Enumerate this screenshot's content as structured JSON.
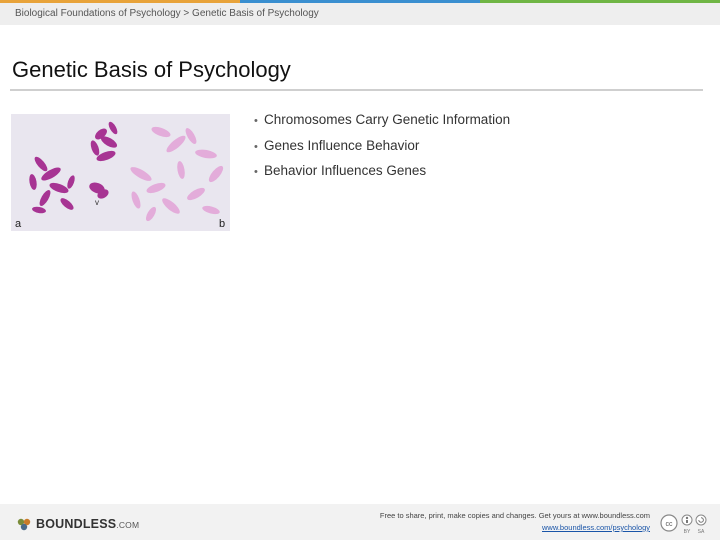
{
  "breadcrumb": "Biological Foundations of Psychology > Genetic Basis of Psychology",
  "title": "Genetic Basis of Psychology",
  "bullets": [
    "Chromosomes Carry Genetic Information",
    "Genes Influence Behavior",
    "Behavior Influences Genes"
  ],
  "figure": {
    "label_a": "a",
    "label_b": "b",
    "label_arrow": "v"
  },
  "footer": {
    "logo_text": "BOUNDLESS",
    "logo_suffix": ".COM",
    "notice": "Free to share, print, make copies and changes. Get yours at www.boundless.com",
    "link": "www.boundless.com/psychology",
    "license": [
      "BY",
      "SA"
    ]
  },
  "colors": {
    "strip": [
      "#e8a33a",
      "#3a8fd0",
      "#6fb544"
    ],
    "chromosome_dark": "#a0218a",
    "chromosome_light": "#e3a6d8",
    "figure_bg": "#e9e6ef",
    "link": "#1a55a8"
  }
}
